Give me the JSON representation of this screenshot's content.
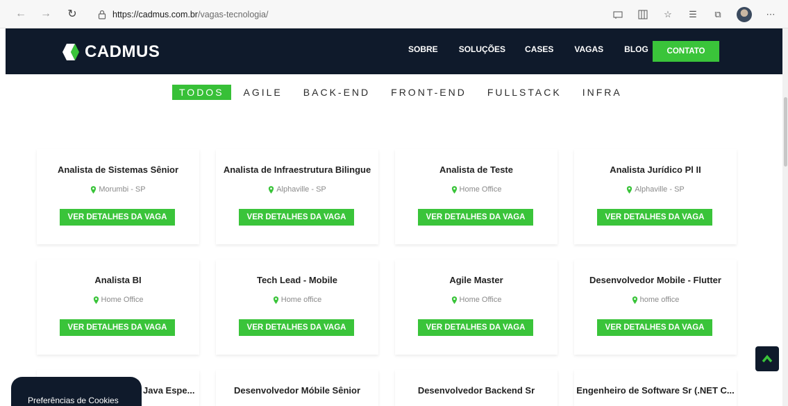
{
  "browser": {
    "url_host": "https://cadmus.com.br",
    "url_path": "/vagas-tecnologia/"
  },
  "header": {
    "logo_text": "CADMUS",
    "menu": [
      "SOBRE",
      "SOLUÇÕES",
      "CASES",
      "VAGAS",
      "BLOG"
    ],
    "contact_label": "CONTATO"
  },
  "filters": [
    "TODOS",
    "AGILE",
    "BACK-END",
    "FRONT-END",
    "FULLSTACK",
    "INFRA"
  ],
  "jobs": [
    {
      "title": "Analista de Sistemas Sênior",
      "location": "Morumbi - SP",
      "button": "VER DETALHES DA VAGA"
    },
    {
      "title": "Analista de Infraestrutura Bilingue",
      "location": "Alphaville - SP",
      "button": "VER DETALHES DA VAGA"
    },
    {
      "title": "Analista de Teste",
      "location": "Home Office",
      "button": "VER DETALHES DA VAGA"
    },
    {
      "title": "Analista Jurídico Pl II",
      "location": "Alphaville - SP",
      "button": "VER DETALHES DA VAGA"
    },
    {
      "title": "Analista BI",
      "location": "Home Office",
      "button": "VER DETALHES DA VAGA"
    },
    {
      "title": "Tech Lead - Mobile",
      "location": "Home office",
      "button": "VER DETALHES DA VAGA"
    },
    {
      "title": "Agile Master",
      "location": "Home Office",
      "button": "VER DETALHES DA VAGA"
    },
    {
      "title": "Desenvolvedor Mobile - Flutter",
      "location": "home office",
      "button": "VER DETALHES DA VAGA"
    },
    {
      "title": "Java Espe...",
      "location": "",
      "button": ""
    },
    {
      "title": "Desenvolvedor Móbile Sênior",
      "location": "",
      "button": ""
    },
    {
      "title": "Desenvolvedor Backend Sr",
      "location": "",
      "button": ""
    },
    {
      "title": "Engenheiro de Software Sr (.NET C...",
      "location": "",
      "button": ""
    }
  ],
  "cookie": {
    "label": "Preferências de Cookies"
  },
  "colors": {
    "navy": "#0f1a2b",
    "green": "#3ac43a"
  }
}
